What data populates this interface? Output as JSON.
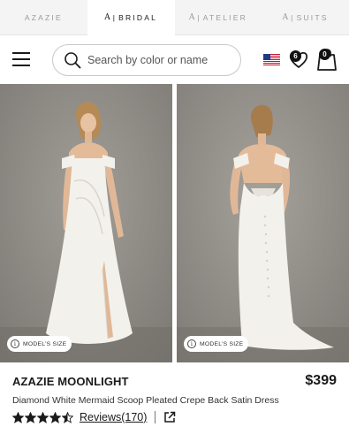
{
  "brand_tabs": [
    {
      "label": "AZAZIE",
      "mark": "",
      "active": false
    },
    {
      "label": "BRIDAL",
      "mark": "A",
      "active": true
    },
    {
      "label": "ATELIER",
      "mark": "A",
      "active": false
    },
    {
      "label": "SUITS",
      "mark": "A",
      "active": false
    }
  ],
  "header": {
    "search_placeholder": "Search by color or name",
    "wishlist_count": "6",
    "cart_count": "0"
  },
  "images": {
    "left_badge": "MODEL'S SIZE",
    "right_badge": "MODEL'S SIZE"
  },
  "product": {
    "name": "AZAZIE MOONLIGHT",
    "price": "$399",
    "description": "Diamond White Mermaid Scoop Pleated Crepe Back Satin Dress",
    "rating": 4.5,
    "reviews_label": "Reviews(170)"
  },
  "colors": {
    "accent": "#1a1a1a",
    "background_photo": "#8a8681",
    "dress": "#f3f1ec"
  }
}
